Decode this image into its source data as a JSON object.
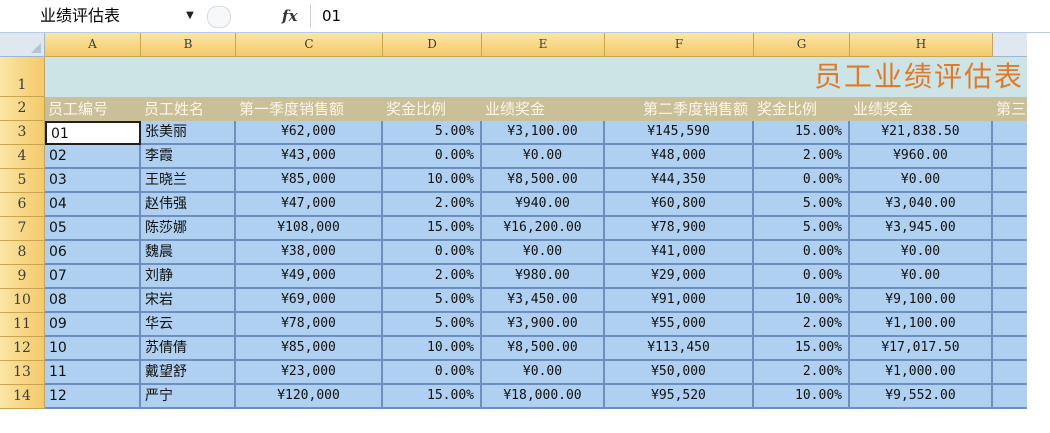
{
  "formula_bar": {
    "name_box": "业绩评估表",
    "fx_label": "fx",
    "formula": "01"
  },
  "columns": [
    "A",
    "B",
    "C",
    "D",
    "E",
    "F",
    "G",
    "H",
    ""
  ],
  "rows": [
    "1",
    "2",
    "3",
    "4",
    "5",
    "6",
    "7",
    "8",
    "9",
    "10",
    "11",
    "12",
    "13",
    "14"
  ],
  "title": "员工业绩评估表",
  "headers": [
    "员工编号",
    "员工姓名",
    "第一季度销售额",
    "奖金比例",
    "业绩奖金",
    "第二季度销售额",
    "奖金比例",
    "业绩奖金",
    "第三"
  ],
  "data_rows": [
    [
      "01",
      "张美丽",
      "¥62,000",
      "5.00%",
      "¥3,100.00",
      "¥145,590",
      "15.00%",
      "¥21,838.50"
    ],
    [
      "02",
      "李霞",
      "¥43,000",
      "0.00%",
      "¥0.00",
      "¥48,000",
      "2.00%",
      "¥960.00"
    ],
    [
      "03",
      "王晓兰",
      "¥85,000",
      "10.00%",
      "¥8,500.00",
      "¥44,350",
      "0.00%",
      "¥0.00"
    ],
    [
      "04",
      "赵伟强",
      "¥47,000",
      "2.00%",
      "¥940.00",
      "¥60,800",
      "5.00%",
      "¥3,040.00"
    ],
    [
      "05",
      "陈莎娜",
      "¥108,000",
      "15.00%",
      "¥16,200.00",
      "¥78,900",
      "5.00%",
      "¥3,945.00"
    ],
    [
      "06",
      "魏晨",
      "¥38,000",
      "0.00%",
      "¥0.00",
      "¥41,000",
      "0.00%",
      "¥0.00"
    ],
    [
      "07",
      "刘静",
      "¥49,000",
      "2.00%",
      "¥980.00",
      "¥29,000",
      "0.00%",
      "¥0.00"
    ],
    [
      "08",
      "宋岩",
      "¥69,000",
      "5.00%",
      "¥3,450.00",
      "¥91,000",
      "10.00%",
      "¥9,100.00"
    ],
    [
      "09",
      "华云",
      "¥78,000",
      "5.00%",
      "¥3,900.00",
      "¥55,000",
      "2.00%",
      "¥1,100.00"
    ],
    [
      "10",
      "苏倩倩",
      "¥85,000",
      "10.00%",
      "¥8,500.00",
      "¥113,450",
      "15.00%",
      "¥17,017.50"
    ],
    [
      "11",
      "戴望舒",
      "¥23,000",
      "0.00%",
      "¥0.00",
      "¥50,000",
      "2.00%",
      "¥1,000.00"
    ],
    [
      "12",
      "严宁",
      "¥120,000",
      "15.00%",
      "¥18,000.00",
      "¥95,520",
      "10.00%",
      "¥9,552.00"
    ]
  ],
  "colors": {
    "title": "#e07a2a",
    "title_band": "#cde4e6",
    "header_band": "#c9c09a",
    "data_cell": "#afd0f0",
    "cell_border": "#6f8fc0",
    "header_gold": "#f4c96a"
  }
}
